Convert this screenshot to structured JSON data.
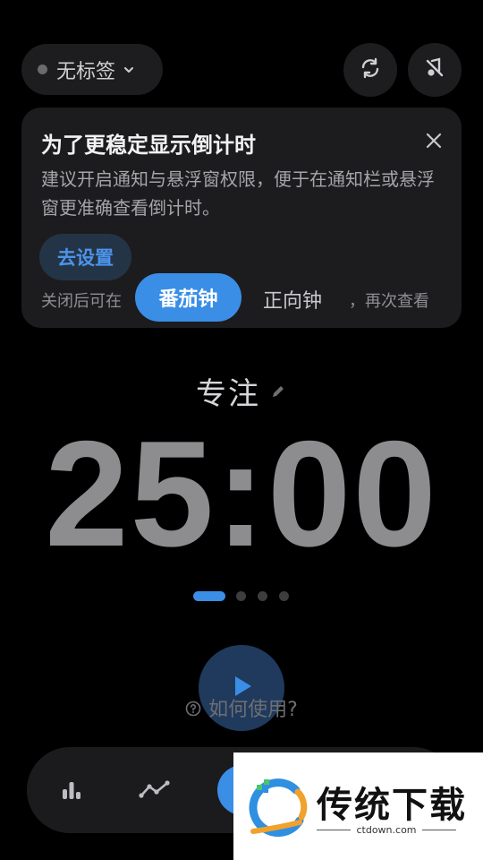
{
  "top_bar": {
    "tag_label": "无标签",
    "sync_icon": "sync-icon",
    "mute_icon": "bell-off-icon"
  },
  "notice": {
    "title": "为了更稳定显示倒计时",
    "body": "建议开启通知与悬浮窗权限，便于在通知栏或悬浮窗更准确查看倒计时。",
    "settings_button": "去设置",
    "footer_left": "关闭后可在",
    "footer_right": "，再次查看"
  },
  "mode_switch": {
    "active": "番茄钟",
    "inactive": "正向钟"
  },
  "focus": {
    "label": "专注"
  },
  "timer": {
    "display": "25:00"
  },
  "pager": {
    "count": 4,
    "active_index": 0
  },
  "help": {
    "label": "如何使用?"
  },
  "bottom_nav": {
    "items": [
      "stats-icon",
      "trend-icon",
      "timer-icon"
    ]
  },
  "watermark": {
    "brand": "传统下载",
    "url": "ctdown.com"
  },
  "colors": {
    "accent": "#3a8ee6",
    "background": "#000000",
    "card": "#1c1c1e",
    "timer_text": "#8d8d90"
  }
}
